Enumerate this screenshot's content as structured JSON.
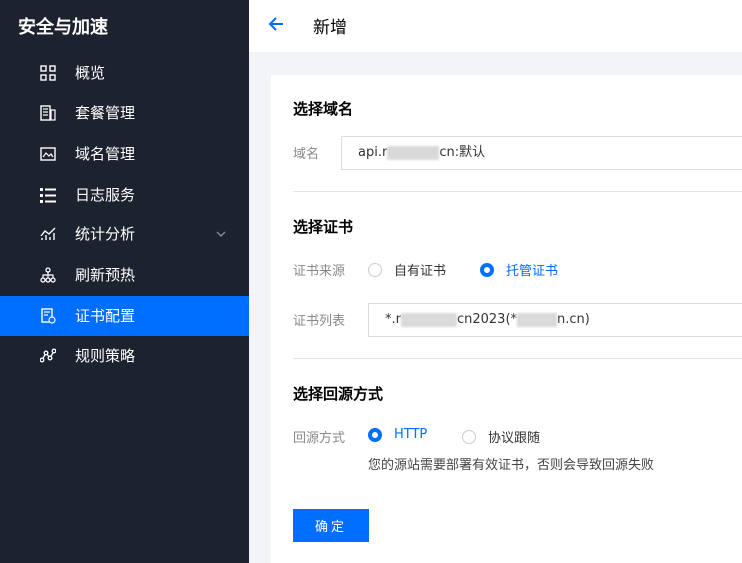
{
  "sidebar": {
    "title": "安全与加速",
    "items": [
      {
        "label": "概览",
        "icon": "grid-icon"
      },
      {
        "label": "套餐管理",
        "icon": "package-icon"
      },
      {
        "label": "域名管理",
        "icon": "image-icon"
      },
      {
        "label": "日志服务",
        "icon": "list-icon"
      },
      {
        "label": "统计分析",
        "icon": "chart-icon"
      },
      {
        "label": "刷新预热",
        "icon": "tree-icon"
      },
      {
        "label": "证书配置",
        "icon": "certificate-icon",
        "active": true
      },
      {
        "label": "规则策略",
        "icon": "nodes-icon"
      }
    ]
  },
  "header": {
    "title": "新增"
  },
  "form": {
    "domain_section": {
      "title": "选择域名",
      "label": "域名",
      "value_prefix": "api.r",
      "value_suffix": "cn:默认"
    },
    "cert_section": {
      "title": "选择证书",
      "source_label": "证书来源",
      "source_options": [
        {
          "label": "自有证书",
          "checked": false
        },
        {
          "label": "托管证书",
          "checked": true
        }
      ],
      "list_label": "证书列表",
      "list_prefix": "*.r",
      "list_middle": "cn2023(*",
      "list_suffix": "n.cn)"
    },
    "origin_section": {
      "title": "选择回源方式",
      "label": "回源方式",
      "options": [
        {
          "label": "HTTP",
          "checked": true
        },
        {
          "label": "协议跟随",
          "checked": false
        }
      ],
      "hint": "您的源站需要部署有效证书，否则会导致回源失败"
    },
    "confirm_label": "确定"
  },
  "colors": {
    "accent": "#006eff",
    "sidebar_bg": "#1c222e"
  }
}
